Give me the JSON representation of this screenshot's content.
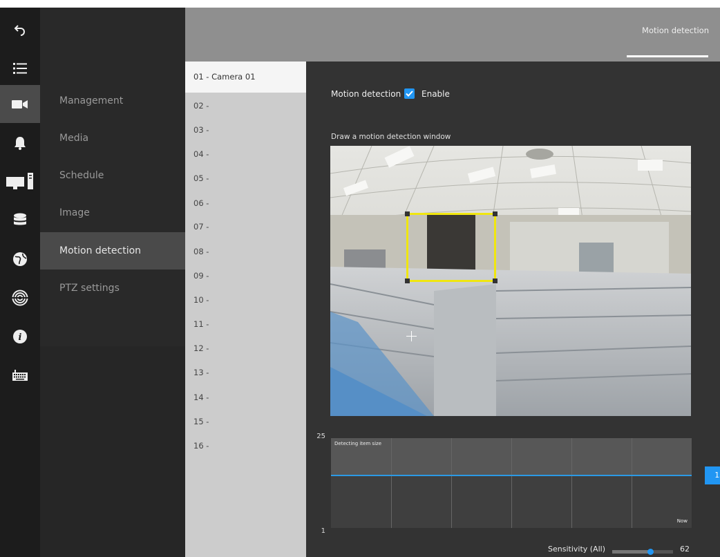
{
  "header": {
    "active_tab": "Motion detection"
  },
  "menu": {
    "items": [
      {
        "label": "Management",
        "active": false
      },
      {
        "label": "Media",
        "active": false
      },
      {
        "label": "Schedule",
        "active": false
      },
      {
        "label": "Image",
        "active": false
      },
      {
        "label": "Motion detection",
        "active": true
      },
      {
        "label": "PTZ settings",
        "active": false
      }
    ]
  },
  "rail": {
    "icons": [
      "back-icon",
      "list-icon",
      "camera-icon",
      "bell-icon",
      "computer-icon",
      "database-icon",
      "globe-icon",
      "spiral-icon",
      "info-icon",
      "keyboard-icon"
    ],
    "active": "camera-icon"
  },
  "cameras": [
    "01 - Camera 01",
    "02 -",
    "03 -",
    "04 -",
    "05 -",
    "06 -",
    "07 -",
    "08 -",
    "09 -",
    "10 -",
    "11 -",
    "12 -",
    "13 -",
    "14 -",
    "15 -",
    "16 -"
  ],
  "selected_camera": "01 - Camera 01",
  "motion": {
    "label": "Motion detection",
    "enable_label": "Enable",
    "enabled": true,
    "draw_label": "Draw a motion detection window"
  },
  "chart": {
    "title": "Detecting item size",
    "now_label": "Now",
    "y_max": "25",
    "y_min": "1",
    "threshold": "15"
  },
  "sensitivity": {
    "label": "Sensitivity (All)",
    "value": "62",
    "percent": 62
  },
  "colors": {
    "accent": "#2196f3",
    "window": "#f0e60f"
  }
}
